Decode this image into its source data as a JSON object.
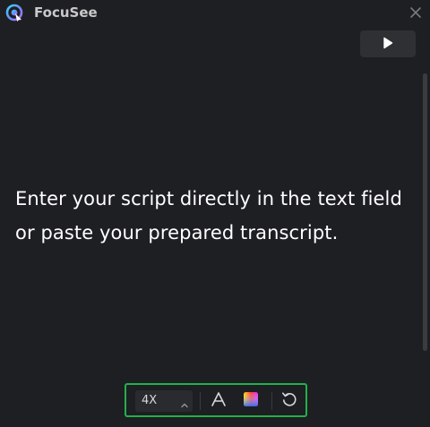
{
  "app": {
    "title": "FocuSee"
  },
  "titlebar": {
    "close_icon": "close-icon"
  },
  "controls": {
    "play_icon": "play-icon"
  },
  "script": {
    "text": "Enter your script directly in the text field or paste your prepared transcript."
  },
  "toolbar": {
    "speed": {
      "value": "4X",
      "icon": "chevron-up-icon"
    },
    "font_icon": "font-icon",
    "color_icon": "color-picker-icon",
    "reset_icon": "reset-icon"
  },
  "colors": {
    "accent": "#22b14c",
    "background": "#1e1f22",
    "text": "#ffffff"
  }
}
